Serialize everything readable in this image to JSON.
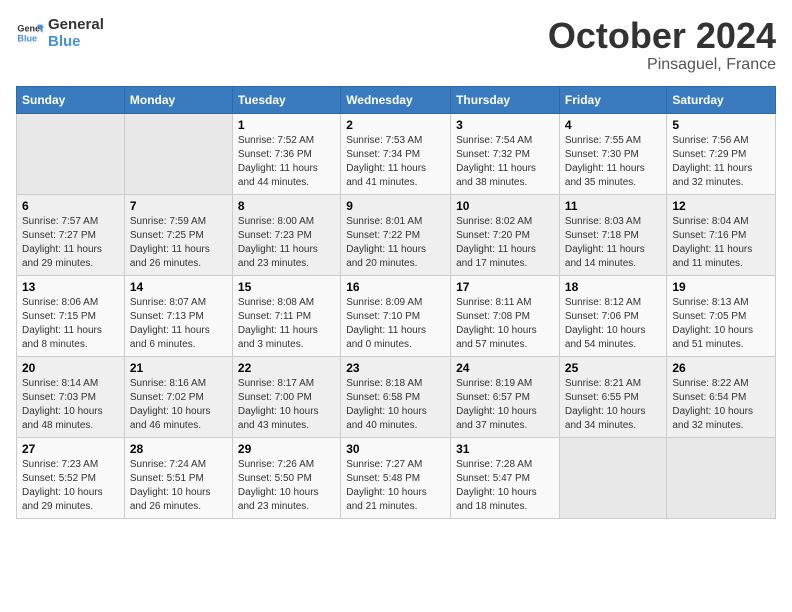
{
  "header": {
    "logo_line1": "General",
    "logo_line2": "Blue",
    "month": "October 2024",
    "location": "Pinsaguel, France"
  },
  "weekdays": [
    "Sunday",
    "Monday",
    "Tuesday",
    "Wednesday",
    "Thursday",
    "Friday",
    "Saturday"
  ],
  "weeks": [
    [
      {
        "day": "",
        "info": ""
      },
      {
        "day": "",
        "info": ""
      },
      {
        "day": "1",
        "info": "Sunrise: 7:52 AM\nSunset: 7:36 PM\nDaylight: 11 hours and 44 minutes."
      },
      {
        "day": "2",
        "info": "Sunrise: 7:53 AM\nSunset: 7:34 PM\nDaylight: 11 hours and 41 minutes."
      },
      {
        "day": "3",
        "info": "Sunrise: 7:54 AM\nSunset: 7:32 PM\nDaylight: 11 hours and 38 minutes."
      },
      {
        "day": "4",
        "info": "Sunrise: 7:55 AM\nSunset: 7:30 PM\nDaylight: 11 hours and 35 minutes."
      },
      {
        "day": "5",
        "info": "Sunrise: 7:56 AM\nSunset: 7:29 PM\nDaylight: 11 hours and 32 minutes."
      }
    ],
    [
      {
        "day": "6",
        "info": "Sunrise: 7:57 AM\nSunset: 7:27 PM\nDaylight: 11 hours and 29 minutes."
      },
      {
        "day": "7",
        "info": "Sunrise: 7:59 AM\nSunset: 7:25 PM\nDaylight: 11 hours and 26 minutes."
      },
      {
        "day": "8",
        "info": "Sunrise: 8:00 AM\nSunset: 7:23 PM\nDaylight: 11 hours and 23 minutes."
      },
      {
        "day": "9",
        "info": "Sunrise: 8:01 AM\nSunset: 7:22 PM\nDaylight: 11 hours and 20 minutes."
      },
      {
        "day": "10",
        "info": "Sunrise: 8:02 AM\nSunset: 7:20 PM\nDaylight: 11 hours and 17 minutes."
      },
      {
        "day": "11",
        "info": "Sunrise: 8:03 AM\nSunset: 7:18 PM\nDaylight: 11 hours and 14 minutes."
      },
      {
        "day": "12",
        "info": "Sunrise: 8:04 AM\nSunset: 7:16 PM\nDaylight: 11 hours and 11 minutes."
      }
    ],
    [
      {
        "day": "13",
        "info": "Sunrise: 8:06 AM\nSunset: 7:15 PM\nDaylight: 11 hours and 8 minutes."
      },
      {
        "day": "14",
        "info": "Sunrise: 8:07 AM\nSunset: 7:13 PM\nDaylight: 11 hours and 6 minutes."
      },
      {
        "day": "15",
        "info": "Sunrise: 8:08 AM\nSunset: 7:11 PM\nDaylight: 11 hours and 3 minutes."
      },
      {
        "day": "16",
        "info": "Sunrise: 8:09 AM\nSunset: 7:10 PM\nDaylight: 11 hours and 0 minutes."
      },
      {
        "day": "17",
        "info": "Sunrise: 8:11 AM\nSunset: 7:08 PM\nDaylight: 10 hours and 57 minutes."
      },
      {
        "day": "18",
        "info": "Sunrise: 8:12 AM\nSunset: 7:06 PM\nDaylight: 10 hours and 54 minutes."
      },
      {
        "day": "19",
        "info": "Sunrise: 8:13 AM\nSunset: 7:05 PM\nDaylight: 10 hours and 51 minutes."
      }
    ],
    [
      {
        "day": "20",
        "info": "Sunrise: 8:14 AM\nSunset: 7:03 PM\nDaylight: 10 hours and 48 minutes."
      },
      {
        "day": "21",
        "info": "Sunrise: 8:16 AM\nSunset: 7:02 PM\nDaylight: 10 hours and 46 minutes."
      },
      {
        "day": "22",
        "info": "Sunrise: 8:17 AM\nSunset: 7:00 PM\nDaylight: 10 hours and 43 minutes."
      },
      {
        "day": "23",
        "info": "Sunrise: 8:18 AM\nSunset: 6:58 PM\nDaylight: 10 hours and 40 minutes."
      },
      {
        "day": "24",
        "info": "Sunrise: 8:19 AM\nSunset: 6:57 PM\nDaylight: 10 hours and 37 minutes."
      },
      {
        "day": "25",
        "info": "Sunrise: 8:21 AM\nSunset: 6:55 PM\nDaylight: 10 hours and 34 minutes."
      },
      {
        "day": "26",
        "info": "Sunrise: 8:22 AM\nSunset: 6:54 PM\nDaylight: 10 hours and 32 minutes."
      }
    ],
    [
      {
        "day": "27",
        "info": "Sunrise: 7:23 AM\nSunset: 5:52 PM\nDaylight: 10 hours and 29 minutes."
      },
      {
        "day": "28",
        "info": "Sunrise: 7:24 AM\nSunset: 5:51 PM\nDaylight: 10 hours and 26 minutes."
      },
      {
        "day": "29",
        "info": "Sunrise: 7:26 AM\nSunset: 5:50 PM\nDaylight: 10 hours and 23 minutes."
      },
      {
        "day": "30",
        "info": "Sunrise: 7:27 AM\nSunset: 5:48 PM\nDaylight: 10 hours and 21 minutes."
      },
      {
        "day": "31",
        "info": "Sunrise: 7:28 AM\nSunset: 5:47 PM\nDaylight: 10 hours and 18 minutes."
      },
      {
        "day": "",
        "info": ""
      },
      {
        "day": "",
        "info": ""
      }
    ]
  ]
}
